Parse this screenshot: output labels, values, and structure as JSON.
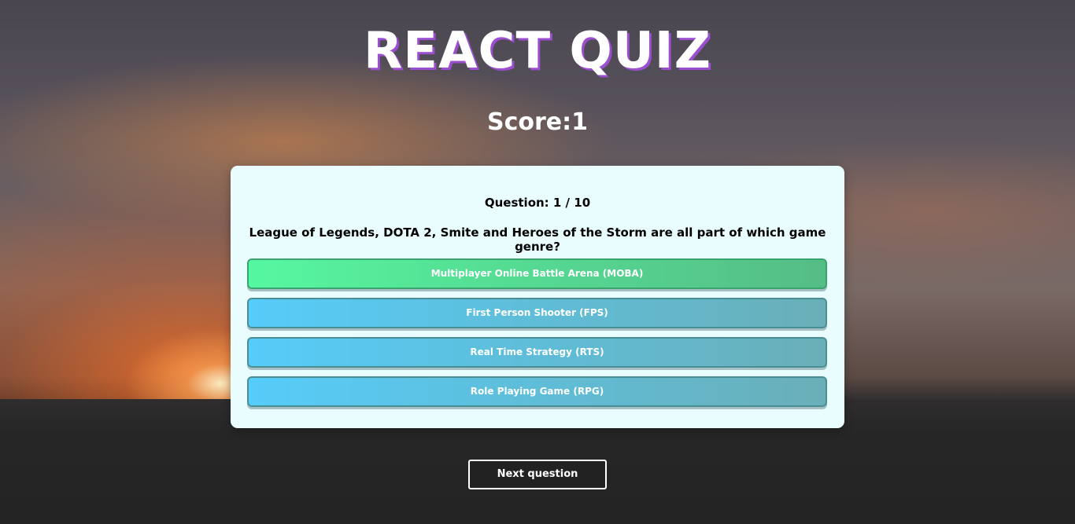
{
  "app": {
    "title": "REACT QUIZ",
    "score_text": "Score:1"
  },
  "quiz": {
    "question_number_text": "Question: 1 / 10",
    "question_text": "League of Legends, DOTA 2, Smite and Heroes of the Storm are all part of which game genre?",
    "answers": [
      {
        "label": "Multiplayer Online Battle Arena (MOBA)",
        "state": "correct"
      },
      {
        "label": "First Person Shooter (FPS)",
        "state": "default"
      },
      {
        "label": "Real Time Strategy (RTS)",
        "state": "default"
      },
      {
        "label": "Role Playing Game (RPG)",
        "state": "default"
      }
    ]
  },
  "controls": {
    "next_label": "Next question"
  },
  "colors": {
    "title_shadow": "#9b4fd0",
    "card_background": "#e9fdff",
    "answer_default": "#56ccf9",
    "answer_correct": "#56f7a1",
    "next_button_border": "#ffffff"
  }
}
